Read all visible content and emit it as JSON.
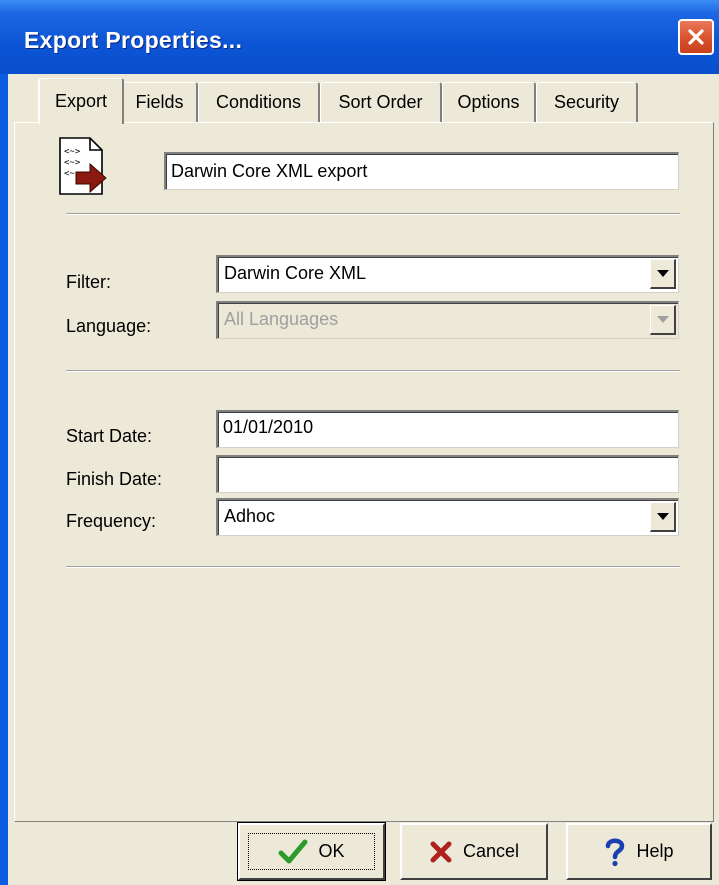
{
  "window": {
    "title": "Export Properties...",
    "close_icon": "close-icon"
  },
  "tabs": [
    {
      "label": "Export",
      "active": true
    },
    {
      "label": "Fields",
      "active": false
    },
    {
      "label": "Conditions",
      "active": false
    },
    {
      "label": "Sort Order",
      "active": false
    },
    {
      "label": "Options",
      "active": false
    },
    {
      "label": "Security",
      "active": false
    }
  ],
  "export_tab": {
    "icon": "xml-export-document-icon",
    "name_value": "Darwin Core XML export",
    "filter": {
      "label": "Filter:",
      "value": "Darwin Core XML"
    },
    "language": {
      "label": "Language:",
      "value": "All Languages",
      "disabled": true
    },
    "start_date": {
      "label": "Start Date:",
      "value": "01/01/2010"
    },
    "finish_date": {
      "label": "Finish Date:",
      "value": ""
    },
    "frequency": {
      "label": "Frequency:",
      "value": "Adhoc"
    }
  },
  "buttons": {
    "ok": {
      "label": "OK",
      "icon": "checkmark-icon"
    },
    "cancel": {
      "label": "Cancel",
      "icon": "x-icon"
    },
    "help": {
      "label": "Help",
      "icon": "question-mark-icon"
    }
  },
  "colors": {
    "titlebar": "#0b55d6",
    "dialog_face": "#ece9d8",
    "ok_check": "#2c9a2c",
    "cancel_x": "#b0201c",
    "help_q": "#1a3fb0",
    "export_arrow": "#8a1a10"
  }
}
